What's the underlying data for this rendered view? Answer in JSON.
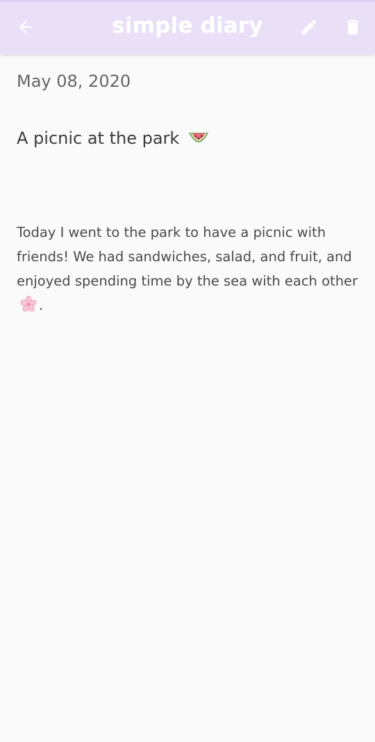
{
  "app_bar": {
    "title": "simple diary",
    "back_icon": "arrow-left-icon",
    "edit_icon": "pencil-icon",
    "delete_icon": "trash-icon",
    "background_color": "#e9e0f8",
    "icon_color": "#ffffff"
  },
  "entry": {
    "date": "May 08, 2020",
    "title": "A picnic at the park",
    "title_emoji": "watermelon-icon",
    "body": "Today I went to the park to have a picnic with friends! We had sandwiches, salad, and fruit, and enjoyed spending time by the sea with each other",
    "body_emoji": "cherry-blossom-icon",
    "body_end": "."
  }
}
